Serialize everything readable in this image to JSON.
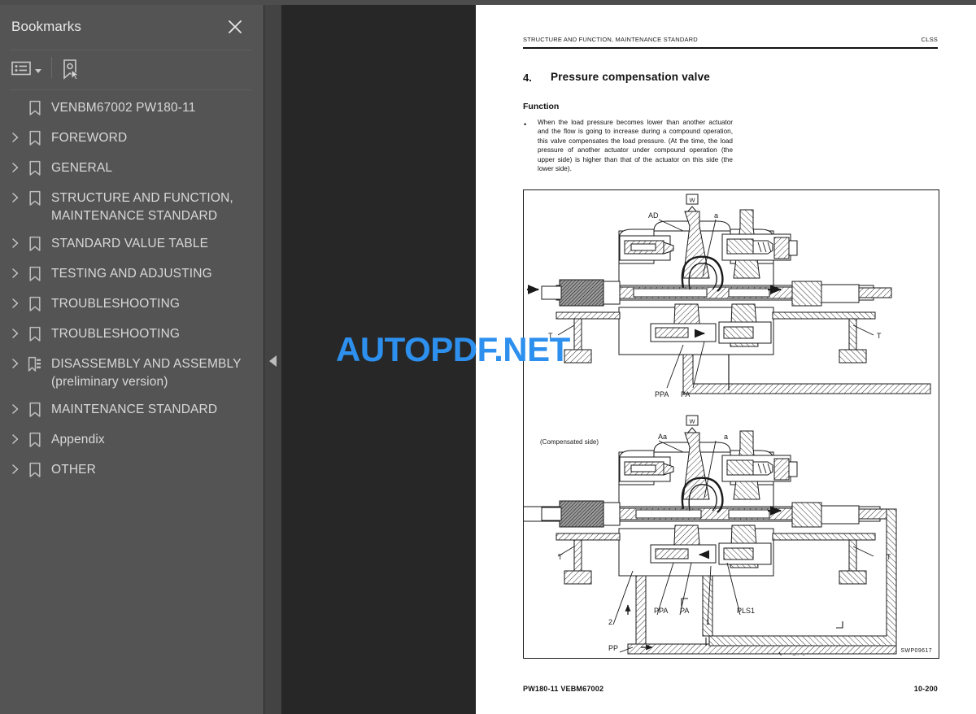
{
  "sidebar": {
    "title": "Bookmarks",
    "close_icon": "close-icon",
    "toolbar": {
      "list_options_icon": "list-options-icon",
      "caret_icon": "chevron-down-icon",
      "new_bookmark_icon": "new-bookmark-icon"
    },
    "items": [
      {
        "label": "VENBM67002 PW180-11",
        "icon": "bookmark-icon",
        "expandable": false
      },
      {
        "label": "FOREWORD",
        "icon": "bookmark-icon",
        "expandable": true
      },
      {
        "label": "GENERAL",
        "icon": "bookmark-icon",
        "expandable": true
      },
      {
        "label": "STRUCTURE AND FUNCTION,\nMAINTENANCE STANDARD",
        "icon": "bookmark-icon",
        "expandable": true
      },
      {
        "label": "STANDARD VALUE TABLE",
        "icon": "bookmark-icon",
        "expandable": true
      },
      {
        "label": "TESTING AND ADJUSTING",
        "icon": "bookmark-icon",
        "expandable": true
      },
      {
        "label": "TROUBLESHOOTING",
        "icon": "bookmark-icon",
        "expandable": true
      },
      {
        "label": "TROUBLESHOOTING",
        "icon": "bookmark-icon",
        "expandable": true
      },
      {
        "label": "DISASSEMBLY AND ASSEMBLY\n(preliminary version)",
        "icon": "structured-bookmark-icon",
        "expandable": true
      },
      {
        "label": "MAINTENANCE STANDARD",
        "icon": "bookmark-icon",
        "expandable": true
      },
      {
        "label": "Appendix",
        "icon": "bookmark-icon",
        "expandable": true
      },
      {
        "label": "OTHER",
        "icon": "bookmark-icon",
        "expandable": true
      }
    ]
  },
  "collapse_handle": {
    "icon": "collapse-left-icon"
  },
  "watermark": {
    "text": "AUTOPDF.NET",
    "color": "#2e90ee"
  },
  "page": {
    "header_left": "STRUCTURE AND FUNCTION, MAINTENANCE STANDARD",
    "header_right": "CLSS",
    "section_number": "4.",
    "section_title": "Pressure compensation valve",
    "subheading": "Function",
    "bullet": "•",
    "body": "When the load pressure becomes lower than another actuator and the flow is going to increase during a compound operation, this valve compensates the load pressure. (At the time, the load pressure of another actuator under compound operation (the upper side) is higher than that of the actuator on this side (the lower side).",
    "footer_left": "PW180-11   VEBM67002",
    "footer_right": "10-200",
    "figure": {
      "code": "SWP09617",
      "upper": {
        "labels": {
          "w_box": "W",
          "ad": "AD",
          "a": "a",
          "t_left": "T",
          "t_right": "T",
          "ppa": "PPA",
          "pa": "PA"
        }
      },
      "lower": {
        "labels": {
          "w_box": "W",
          "compensated_side": "(Compensated side)",
          "aa": "Aa",
          "a": "a",
          "t_left": "T",
          "t_right": "T",
          "two": "2",
          "ppa": "PPA",
          "pa": "PA",
          "one": "1",
          "pls1": "PLS1",
          "pp": "PP",
          "pls": "PLS"
        }
      }
    }
  }
}
